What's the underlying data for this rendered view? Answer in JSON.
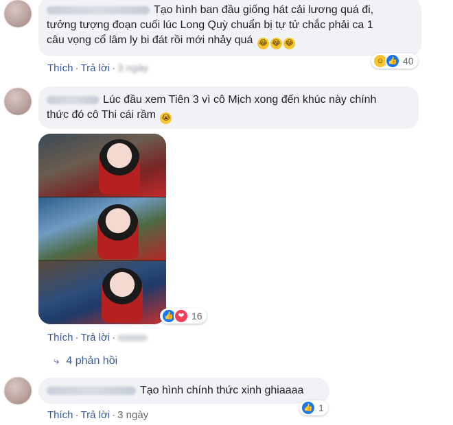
{
  "comments": [
    {
      "lines": [
        "Tạo hình ban đầu giống hát cải lương quá đi,",
        "tưởng tượng đoạn cuối lúc Long Quỳ chuẩn bị tự tử chắc phải ca 1",
        "câu vọng cổ lâm ly bi đát rồi mới nhảy quá"
      ],
      "emojis": [
        "😂",
        "😂",
        "😂"
      ],
      "like_label": "Thích",
      "reply_label": "Trả lời",
      "time": "3 ngày",
      "reaction_count": "40"
    },
    {
      "lines": [
        "Lúc đầu xem Tiên 3 vì cô Mịch xong đến khúc này chính",
        "thức đó cô Thi cái rầm"
      ],
      "emojis": [
        "😭"
      ],
      "like_label": "Thích",
      "reply_label": "Trả lời",
      "reaction_count": "16",
      "replies_label": "4 phản hồi"
    },
    {
      "lines": [
        "Tạo hình chính thức xinh ghiaaaa"
      ],
      "like_label": "Thích",
      "reply_label": "Trả lời",
      "time": "3 ngày",
      "reaction_count": "1"
    }
  ],
  "icons": {
    "like": "thumbs-up-icon",
    "haha": "laughing-face-icon",
    "love": "heart-icon",
    "reply_arrow": "reply-arrow-icon"
  },
  "colors": {
    "link": "#385898",
    "bubble": "#f0f2f5",
    "like": "#1877f2",
    "love": "#f33e58",
    "haha": "#f7c531"
  }
}
